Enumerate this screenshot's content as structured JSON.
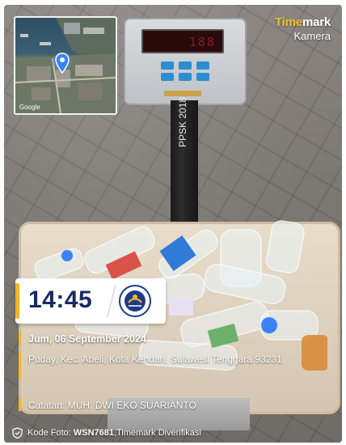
{
  "watermark": {
    "brand_highlight": "Time",
    "brand_rest": "mark",
    "sub": "Kamera"
  },
  "map": {
    "attribution": "Google"
  },
  "scale": {
    "display": "188",
    "pole_text": "PPSK 2018"
  },
  "stamp": {
    "time": "14:45",
    "date": "Jum, 06 September 2024",
    "address": "Puday, Kec. Abeli, Kota Kendari, Sulawesi Tenggara 93231",
    "note": "Catatan: MUH. DWI EKO SUARIANTO"
  },
  "footer": {
    "label": "Kode Foto: ",
    "code": "WSN7681",
    "suffix": ",Timemark Diverifikasi"
  },
  "colors": {
    "accent": "#f2b526",
    "time_text": "#172a63",
    "brand_accent": "#f2c12e"
  },
  "icons": [
    "map-pin-icon",
    "organization-logo-icon",
    "verified-shield-icon"
  ]
}
